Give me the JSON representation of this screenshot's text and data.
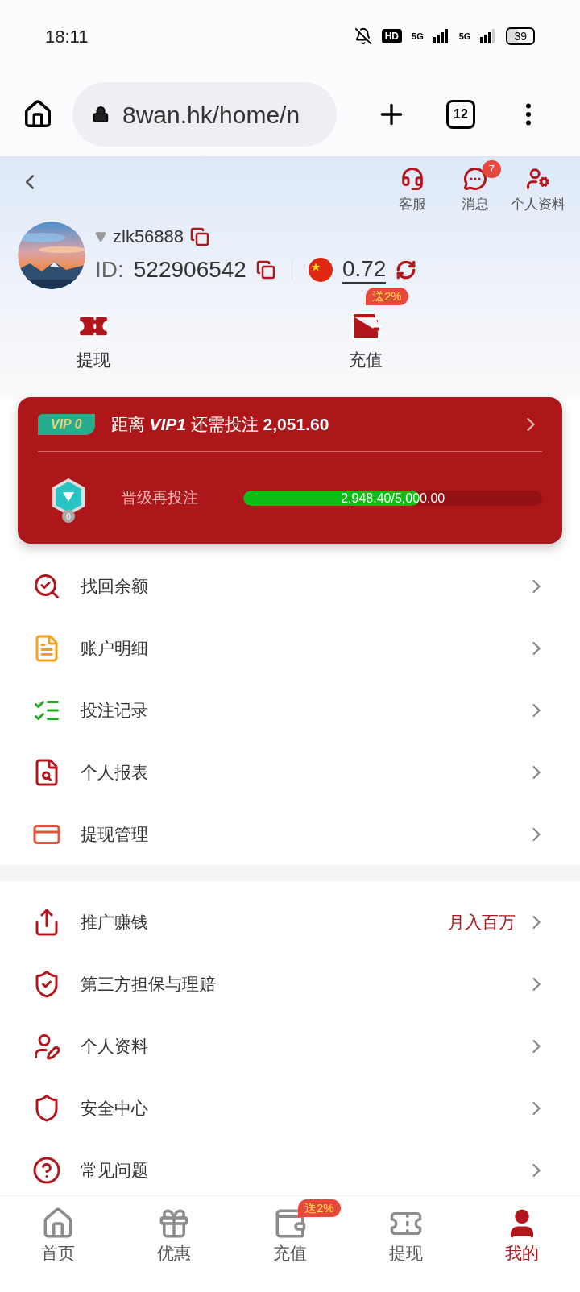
{
  "status_bar": {
    "time": "18:11",
    "hd_label": "HD",
    "network_1": "5G",
    "network_2": "5G",
    "battery": "39"
  },
  "browser": {
    "url": "8wan.hk/home/n",
    "tab_count": "12"
  },
  "header": {
    "actions": [
      {
        "label": "客服"
      },
      {
        "label": "消息",
        "badge": "7"
      },
      {
        "label": "个人资料"
      }
    ],
    "username": "zlk56888",
    "id_label": "ID:",
    "id_value": "522906542",
    "balance": "0.72"
  },
  "quick_actions": [
    {
      "label": "提现"
    },
    {
      "label": "充值",
      "badge": "送2%"
    }
  ],
  "vip": {
    "badge": "VIP 0",
    "summary": "距离 *VIP1* 还需投注 **2,051.60**",
    "medal_level": "0",
    "progress_label": "晋级再投注",
    "progress_text": "2,948.40/5,000.00",
    "level": 0.59
  },
  "menu_groups": [
    {
      "items": [
        {
          "label": "找回余额"
        },
        {
          "label": "账户明细"
        },
        {
          "label": "投注记录"
        },
        {
          "label": "个人报表"
        },
        {
          "label": "提现管理"
        }
      ]
    },
    {
      "items": [
        {
          "label": "推广赚钱",
          "note": "月入百万"
        },
        {
          "label": "第三方担保与理赔"
        },
        {
          "label": "个人资料"
        },
        {
          "label": "安全中心"
        },
        {
          "label": "常见问题"
        }
      ]
    }
  ],
  "bottom_nav": [
    {
      "label": "首页",
      "selected": false
    },
    {
      "label": "优惠",
      "selected": false
    },
    {
      "label": "充值",
      "selected": false,
      "badge": "送2%"
    },
    {
      "label": "提现",
      "selected": false
    },
    {
      "label": "我的",
      "selected": true
    }
  ]
}
